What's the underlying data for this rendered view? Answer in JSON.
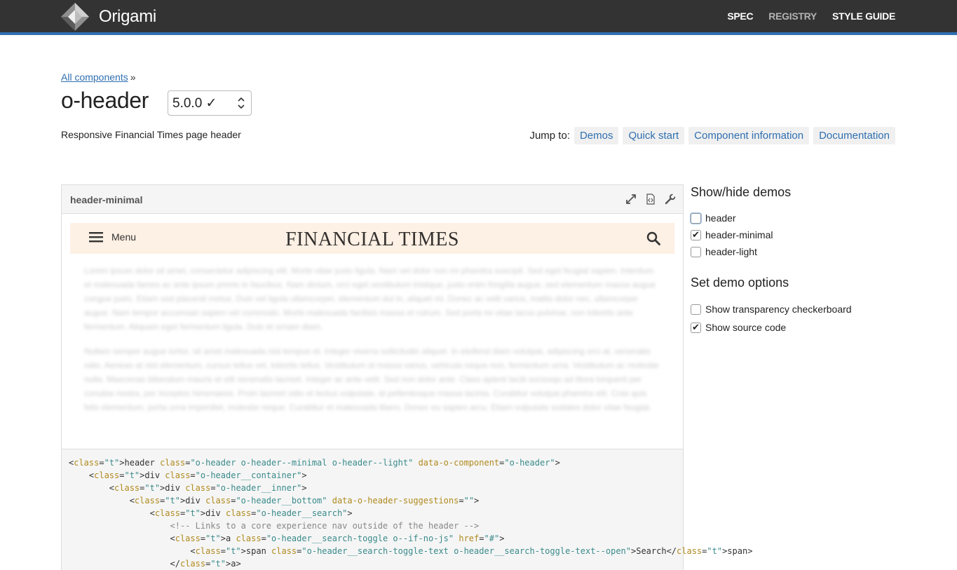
{
  "app": {
    "brand": "Origami",
    "nav": [
      {
        "label": "SPEC",
        "muted": false
      },
      {
        "label": "REGISTRY",
        "muted": true
      },
      {
        "label": "STYLE GUIDE",
        "muted": false
      }
    ]
  },
  "breadcrumb": {
    "link": "All components",
    "separator": "»"
  },
  "component": {
    "name": "o-header",
    "version": "5.0.0 ✓",
    "description": "Responsive Financial Times page header"
  },
  "jump": {
    "label": "Jump to:",
    "links": [
      "Demos",
      "Quick start",
      "Component information",
      "Documentation"
    ]
  },
  "demo": {
    "name": "header-minimal",
    "menu_label": "Menu",
    "logo_text": "FINANCIAL TIMES",
    "lorem_1": "Lorem ipsum dolor sit amet, consectetur adipiscing elit. Morbi vitae justo ligula. Nam vel dolor non mi pharetra suscipit. Sed eget feugiat sapien. Interdum et malesuada fames ac ante ipsum primis in faucibus. Nam dictum, orci eget vestibulum tristique, justo enim fringilla augue, sed elementum massa augue congue justo. Etiam sed placerat metus. Duis vel ligula ullamcorper, elementum dui in, aliquet mi. Donec ac velit varius, mattis dolor nec, ullamcorper augue. Nam tempor accumsan sapien vel commodo. Morbi malesuada facilisis massa et rutrum. Sed porta mi vitae lacus pulvinar, non lobortis ante fermentum. Aliquam eget fermentum ligula. Duis et ornare diam.",
    "lorem_2": "Nullam semper augue tortor, sit amet malesuada nisl tempus et. Integer viverra sollicitudin aliquet. In eleifend diam volutpat, adipiscing orci at, venenatis odio. Aenean at nisl elementum, cursus tellus vel, lobortis tellus. Vestibulum id massa varius, vehicula neque non, fermentum urna. Vestibulum ac molestie nulla. Maecenas bibendum mauris et elit venenatis laoreet. Integer ac ante velit. Sed non dolor ante. Class aptent taciti sociosqu ad litora torquent per conubia nostra, per inceptos himenaeos. Proin laoreet odio et lectus vulputate, id pellentesque massa lacinia. Curabitur volutpat pharetra elit. Cras quis felis elementum, porta urna imperdiet, molestie neque. Curabitur et malesuada libero. Donec eu sapien arcu. Etiam vulputate sodales dolor vitae feugiat."
  },
  "source_code_lines": [
    "<header class=\"o-header o-header--minimal o-header--light\" data-o-component=\"o-header\">",
    "    <div class=\"o-header__container\">",
    "        <div class=\"o-header__inner\">",
    "            <div class=\"o-header__bottom\" data-o-header-suggestions=\"\">",
    "                <div class=\"o-header__search\">",
    "                    <!-- Links to a core experience nav outside of the header -->",
    "                    <a class=\"o-header__search-toggle o--if-no-js\" href=\"#\">",
    "                        <span class=\"o-header__search-toggle-text o-header__search-toggle-text--open\">Search</span>",
    "                    </a>"
  ],
  "sidebar": {
    "show_hide_title": "Show/hide demos",
    "demos": [
      {
        "label": "header",
        "checked": false
      },
      {
        "label": "header-minimal",
        "checked": true
      },
      {
        "label": "header-light",
        "checked": false
      }
    ],
    "options_title": "Set demo options",
    "options": [
      {
        "label": "Show transparency checkerboard",
        "checked": false
      },
      {
        "label": "Show source code",
        "checked": true
      }
    ]
  },
  "colors": {
    "navbar": "#333333",
    "accent": "#2f6fb0",
    "ft_header_bg": "#fdf0e4"
  }
}
